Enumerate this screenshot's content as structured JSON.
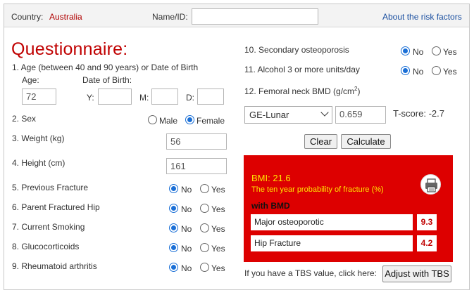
{
  "header": {
    "country_label": "Country:",
    "country_value": "Australia",
    "name_label": "Name/ID:",
    "name_value": "",
    "about_link": "About the risk factors"
  },
  "title": "Questionnaire:",
  "q1": {
    "label": "1. Age (between 40 and 90 years) or Date of Birth",
    "age_label": "Age:",
    "age_value": "72",
    "dob_label": "Date of Birth:",
    "y_label": "Y:",
    "m_label": "M:",
    "d_label": "D:",
    "y_value": "",
    "m_value": "",
    "d_value": ""
  },
  "sex": {
    "label": "2. Sex",
    "male": "Male",
    "female": "Female",
    "selected": "Female"
  },
  "weight": {
    "label": "3. Weight (kg)",
    "value": "56"
  },
  "height": {
    "label": "4. Height (cm)",
    "value": "161"
  },
  "yes_label": "Yes",
  "no_label": "No",
  "questions": [
    {
      "label": "5. Previous Fracture",
      "answer": "No"
    },
    {
      "label": "6. Parent Fractured Hip",
      "answer": "No"
    },
    {
      "label": "7. Current Smoking",
      "answer": "No"
    },
    {
      "label": "8. Glucocorticoids",
      "answer": "No"
    },
    {
      "label": "9. Rheumatoid arthritis",
      "answer": "No"
    },
    {
      "label": "10. Secondary osteoporosis",
      "answer": "No"
    },
    {
      "label": "11. Alcohol 3 or more units/day",
      "answer": "No"
    }
  ],
  "bmd": {
    "label": "12. Femoral neck BMD (g/cm",
    "label_sup": "2",
    "label_end": ")",
    "device": "GE-Lunar",
    "value": "0.659",
    "tscore": "T-score: -2.7"
  },
  "buttons": {
    "clear": "Clear",
    "calculate": "Calculate"
  },
  "result": {
    "bmi": "BMI: 21.6",
    "prob_title": "The ten year probability of fracture (%)",
    "with_bmd": "with BMD",
    "major_label": "Major osteoporotic",
    "major_value": "9.3",
    "hip_label": "Hip Fracture",
    "hip_value": "4.2",
    "background": "#dd0000",
    "accent": "#ffe600"
  },
  "tbs": {
    "prompt": "If you have a TBS value, click here:",
    "button": "Adjust with TBS"
  },
  "icons": {
    "print": "printer-icon",
    "dropdown": "chevron-down-icon"
  }
}
